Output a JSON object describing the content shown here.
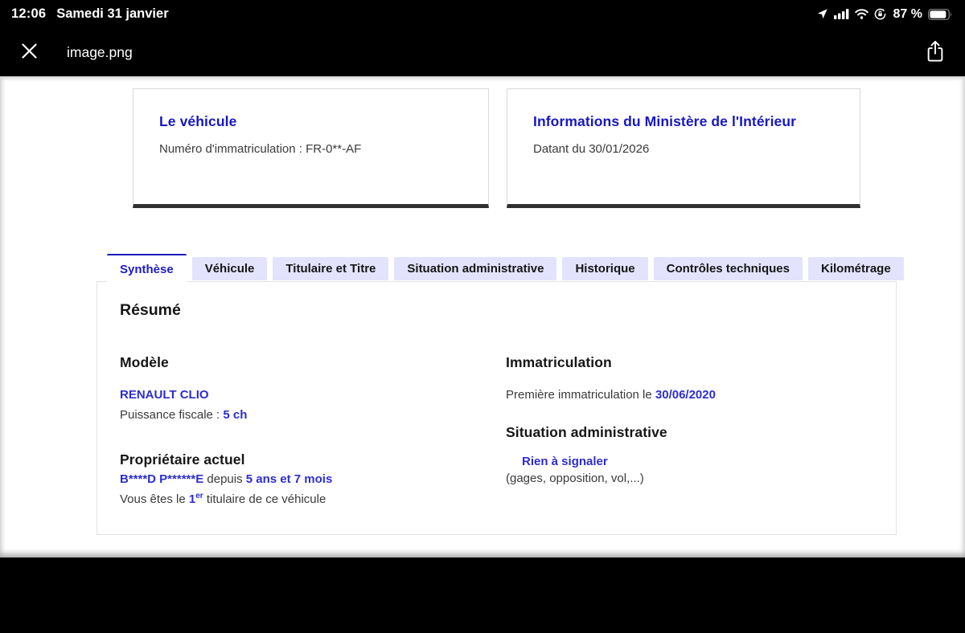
{
  "status_bar": {
    "time": "12:06",
    "date": "Samedi 31 janvier",
    "battery_percent": "87 %",
    "icons": [
      "location-icon",
      "cellular-signal-icon",
      "wifi-icon",
      "rotation-lock-icon",
      "battery-icon"
    ]
  },
  "toolbar": {
    "title": "image.png",
    "close_icon": "close-icon",
    "share_icon": "share-icon"
  },
  "page": {
    "cards": [
      {
        "title": "Le véhicule",
        "subtitle": "Numéro d'immatriculation : FR-0**-AF"
      },
      {
        "title": "Informations du Ministère de l'Intérieur",
        "subtitle": "Datant du 30/01/2026"
      }
    ],
    "tabs": [
      {
        "label": "Synthèse",
        "active": true
      },
      {
        "label": "Véhicule",
        "active": false
      },
      {
        "label": "Titulaire et Titre",
        "active": false
      },
      {
        "label": "Situation administrative",
        "active": false
      },
      {
        "label": "Historique",
        "active": false
      },
      {
        "label": "Contrôles techniques",
        "active": false
      },
      {
        "label": "Kilométrage",
        "active": false
      }
    ],
    "summary": {
      "title": "Résumé",
      "model": {
        "heading": "Modèle",
        "name": "RENAULT CLIO",
        "power_label": "Puissance fiscale : ",
        "power_value": "5 ch"
      },
      "owner": {
        "heading": "Propriétaire actuel",
        "name": "B****D P******E",
        "depuis": " depuis ",
        "duration": "5 ans et 7 mois",
        "holder_prefix": "Vous êtes le ",
        "holder_num": "1",
        "holder_sup": "er",
        "holder_suffix": " titulaire de ce véhicule"
      },
      "registration": {
        "heading": "Immatriculation",
        "label": "Première immatriculation le ",
        "date": "30/06/2020"
      },
      "situation": {
        "heading": "Situation administrative",
        "status": "Rien à signaler",
        "note": "(gages, opposition, vol,...)"
      }
    },
    "colors": {
      "heading_blue": "#1717c4",
      "value_blue": "#2d2dd2",
      "tab_active_blue": "#1d1dc8",
      "tab_inactive_bg": "#e3e3fd",
      "body_gray": "#3a3a3a",
      "card_bottom_border": "#2f2f2f"
    }
  }
}
